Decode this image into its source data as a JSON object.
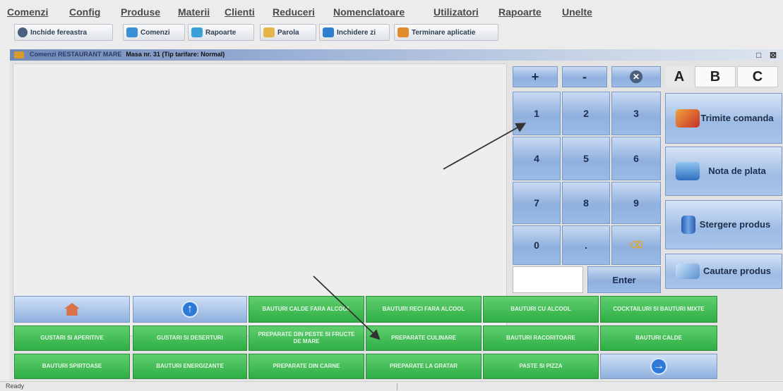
{
  "menu": [
    "Comenzi",
    "Config",
    "Produse",
    "Materii",
    "Clienti",
    "Reduceri",
    "Nomenclatoare",
    "Utilizatori",
    "Rapoarte",
    "Unelte"
  ],
  "toolbar": [
    {
      "label": "Inchide fereastra",
      "icon": "close-icon"
    },
    {
      "label": "Comenzi",
      "icon": "orders-icon"
    },
    {
      "label": "Rapoarte",
      "icon": "reports-icon"
    },
    {
      "label": "Parola",
      "icon": "password-icon"
    },
    {
      "label": "Inchidere zi",
      "icon": "day-close-icon"
    },
    {
      "label": "Terminare aplicatie",
      "icon": "exit-icon"
    }
  ],
  "window": {
    "title": "Comenzi RESTAURANT MARE",
    "subtitle": "Masa nr. 31 (Tip tarifare: Normal)",
    "restore": "□",
    "close": "⊠"
  },
  "keypad": {
    "plus": "+",
    "minus": "-",
    "clear_icon": "clear-icon",
    "digits": [
      "1",
      "2",
      "3",
      "4",
      "5",
      "6",
      "7",
      "8",
      "9",
      "0",
      "."
    ],
    "backspace_icon": "backspace-icon",
    "enter": "Enter",
    "input_value": ""
  },
  "letters": [
    "A",
    "B",
    "C"
  ],
  "actions": [
    {
      "label": "Trimite comanda",
      "icon": "rocket-icon"
    },
    {
      "label": "Nota de plata",
      "icon": "folder-icon"
    },
    {
      "label": "Stergere produs",
      "icon": "database-delete-icon"
    },
    {
      "label": "Cautare produs",
      "icon": "magnifier-icon"
    }
  ],
  "categories": {
    "row1": [
      "Bauturi calde fara alcool",
      "Bauturi reci fara alcool",
      "Bauturi cu alcool",
      "Cocktailuri si bauturi mixte"
    ],
    "row2": [
      "Gustari si aperitive",
      "Gustari si deserturi",
      "Preparate din peste si fructe de mare",
      "Preparate culinare",
      "Bauturi racoritoare",
      "Bauturi calde"
    ],
    "row3": [
      "Bauturi spirtoase",
      "Bauturi energizante",
      "Preparate din carne",
      "Preparate la gratar",
      "Paste si pizza"
    ]
  },
  "nav": {
    "home_icon": "home-icon",
    "up_icon": "arrow-up-icon",
    "next_icon": "arrow-right-icon"
  },
  "status": "Ready",
  "colors": {
    "green": "#2fae45",
    "blue": "#8fb0de",
    "title": "#6f86b8"
  }
}
